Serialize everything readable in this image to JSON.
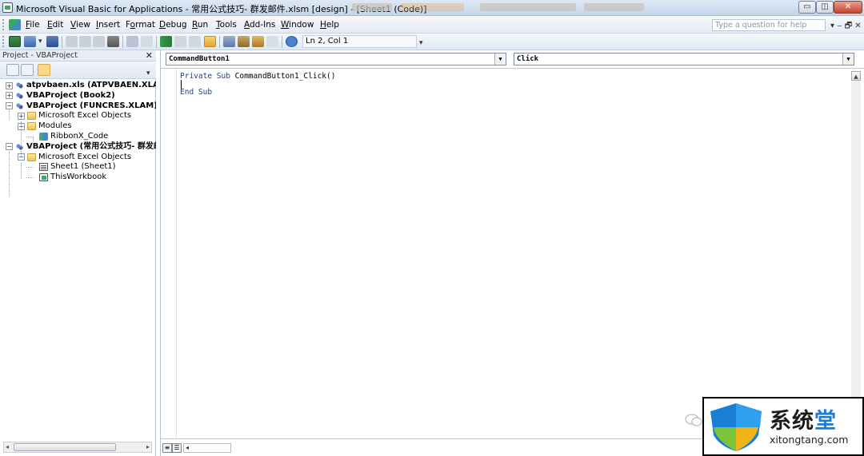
{
  "window": {
    "title": "Microsoft Visual Basic for Applications - 常用公式技巧- 群发邮件.xlsm [design] - [Sheet1 (Code)]",
    "min_label": "▭",
    "restore_label": "◫",
    "close_label": "✕"
  },
  "menubar": {
    "items": [
      "File",
      "Edit",
      "View",
      "Insert",
      "Format",
      "Debug",
      "Run",
      "Tools",
      "Add-Ins",
      "Window",
      "Help"
    ],
    "underline": [
      "F",
      "E",
      "V",
      "I",
      "o",
      "D",
      "R",
      "T",
      "A",
      "W",
      "H"
    ],
    "question_placeholder": "Type a question for help",
    "doc_controls": "▾  ‒  🗗  ✕"
  },
  "toolbar": {
    "position_label": "Ln 2, Col 1"
  },
  "project": {
    "title": "Project - VBAProject",
    "close": "✕",
    "tree": [
      {
        "label": "atpvbaen.xls (ATPVBAEN.XLAM)",
        "bold": true,
        "level": 0,
        "expander": "+",
        "icon": "vba"
      },
      {
        "label": "VBAProject (Book2)",
        "bold": true,
        "level": 0,
        "expander": "+",
        "icon": "vba"
      },
      {
        "label": "VBAProject (FUNCRES.XLAM)",
        "bold": true,
        "level": 0,
        "expander": "−",
        "icon": "vba"
      },
      {
        "label": "Microsoft Excel Objects",
        "bold": false,
        "level": 1,
        "expander": "+",
        "icon": "folder"
      },
      {
        "label": "Modules",
        "bold": false,
        "level": 1,
        "expander": "−",
        "icon": "folder"
      },
      {
        "label": "RibbonX_Code",
        "bold": false,
        "level": 2,
        "expander": "",
        "icon": "module"
      },
      {
        "label": "VBAProject (常用公式技巧- 群发邮件.xlsm)",
        "bold": true,
        "level": 0,
        "expander": "−",
        "icon": "vba"
      },
      {
        "label": "Microsoft Excel Objects",
        "bold": false,
        "level": 1,
        "expander": "−",
        "icon": "folder"
      },
      {
        "label": "Sheet1 (Sheet1)",
        "bold": false,
        "level": 2,
        "expander": "",
        "icon": "sheet"
      },
      {
        "label": "ThisWorkbook",
        "bold": false,
        "level": 2,
        "expander": "",
        "icon": "workbook"
      }
    ]
  },
  "code": {
    "object_combo": "CommandButton1",
    "procedure_combo": "Click",
    "lines": [
      {
        "keyword": "Private Sub",
        "rest": " CommandButton1_Click()"
      },
      {
        "keyword": "",
        "rest": ""
      },
      {
        "keyword": "End Sub",
        "rest": ""
      }
    ]
  },
  "watermark": {
    "brand_cn_a": "系统",
    "brand_cn_b": "堂",
    "brand_url": "xitongtang.com"
  },
  "colors": {
    "accent": "#1a7ed6",
    "keyword": "#1d3d8a",
    "title_bg": "#c3d5ea"
  }
}
